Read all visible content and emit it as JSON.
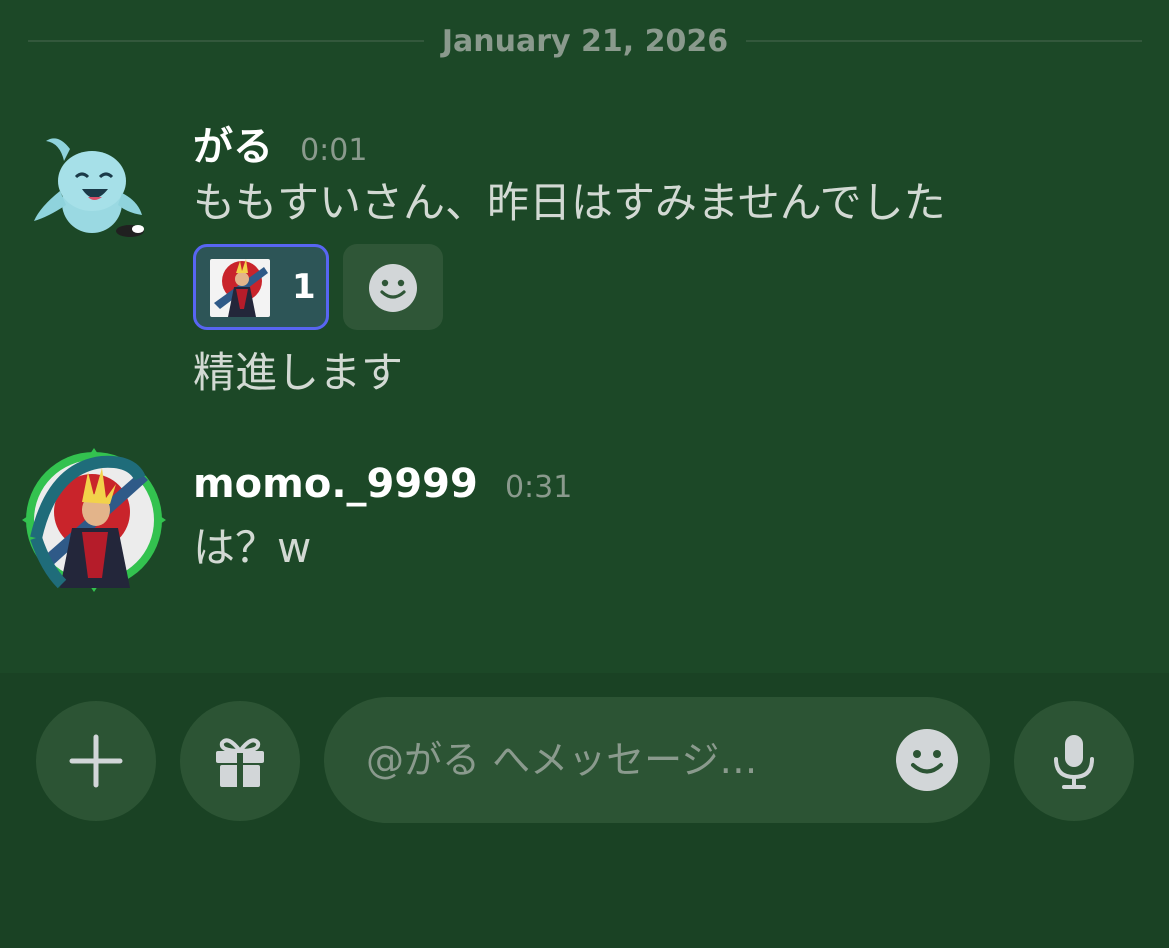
{
  "date_divider": "January 21, 2026",
  "messages": [
    {
      "username": "がる",
      "time": "0:01",
      "lines": [
        "ももすいさん、昨日はすみませんでした",
        "精進します"
      ],
      "reactions": [
        {
          "emoji": "anime-character-emoji",
          "count": "1",
          "active": true
        }
      ]
    },
    {
      "username": "momo._9999",
      "time": "0:31",
      "lines": [
        "は？w"
      ]
    }
  ],
  "composer": {
    "placeholder": "@がる へメッセージ…",
    "buttons": [
      "plus-icon",
      "gift-icon",
      "microphone-icon"
    ]
  },
  "colors": {
    "background": "#1c4827",
    "composer_background": "#1a4224",
    "control_background": "#2c5434",
    "reaction_active_border": "#5865f2",
    "muted_text": "#8a9a8d"
  }
}
